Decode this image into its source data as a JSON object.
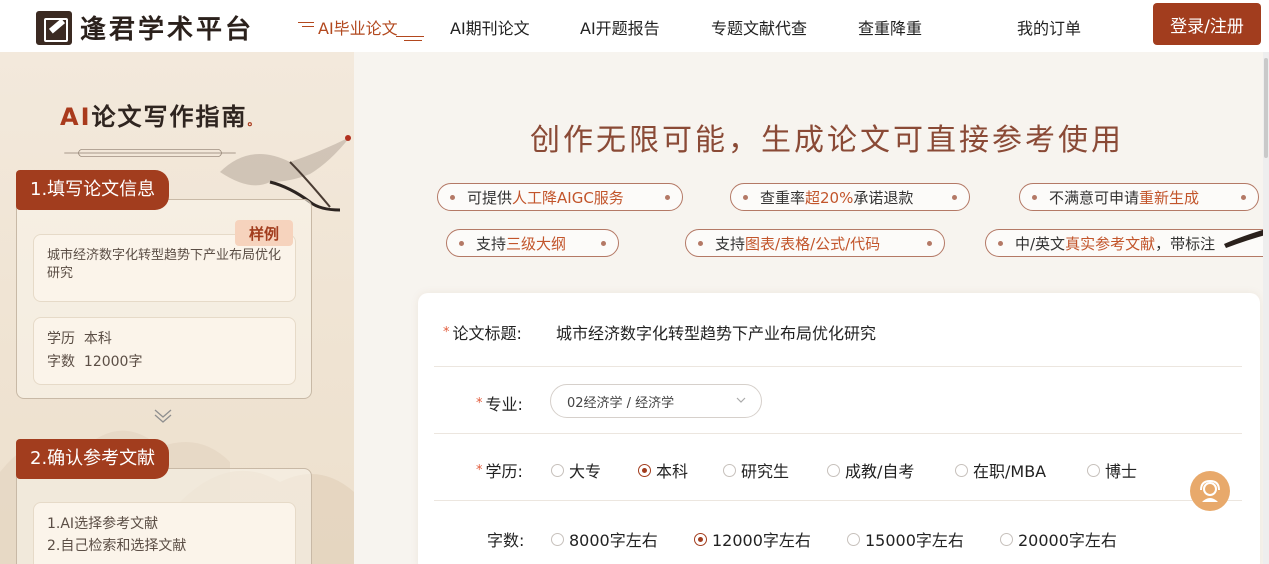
{
  "brand": {
    "name": "逢君学术平台",
    "logo_icon": "quill-logo-icon"
  },
  "nav": {
    "items": [
      {
        "label": "AI毕业论文",
        "active": true
      },
      {
        "label": "AI期刊论文",
        "active": false
      },
      {
        "label": "AI开题报告",
        "active": false
      },
      {
        "label": "专题文献代查",
        "active": false
      },
      {
        "label": "查重降重",
        "active": false
      },
      {
        "label": "我的订单",
        "active": false
      }
    ],
    "login_label": "登录/注册"
  },
  "sidebar": {
    "guide_ai": "AI",
    "guide_title": "论文写作指南",
    "guide_dot": "。",
    "step1": {
      "tag": "1.填写论文信息",
      "sample_badge": "样例",
      "sample_title": "城市经济数字化转型趋势下产业布局优化研究",
      "degree_label": "学历",
      "degree_value": "本科",
      "words_label": "字数",
      "words_value": "12000字"
    },
    "step2": {
      "tag": "2.确认参考文献",
      "line1": "1.AI选择参考文献",
      "line2": "2.自己检索和选择文献"
    }
  },
  "hero": {
    "title": "创作无限可能，生成论文可直接参考使用",
    "pills": [
      {
        "pre": "可提供",
        "hl": "人工降AIGC服务",
        "post": ""
      },
      {
        "pre": "查重率",
        "hl": "超20%",
        "post": "承诺退款"
      },
      {
        "pre": "不满意可申请",
        "hl": "重新生成",
        "post": ""
      },
      {
        "pre": "支持",
        "hl": "三级大纲",
        "post": ""
      },
      {
        "pre": "支持",
        "hl": "图表/表格/公式/代码",
        "post": ""
      },
      {
        "pre": "中/英文",
        "hl": "真实参考文献",
        "post": "，带标注"
      }
    ]
  },
  "form": {
    "title_label": "论文标题:",
    "title_value": "城市经济数字化转型趋势下产业布局优化研究",
    "major_label": "专业:",
    "major_value": "02经济学 / 经济学",
    "degree_label": "学历:",
    "degree_options": [
      "大专",
      "本科",
      "研究生",
      "成教/自考",
      "在职/MBA",
      "博士"
    ],
    "degree_selected": "本科",
    "words_label": "字数:",
    "words_options": [
      "8000字左右",
      "12000字左右",
      "15000字左右",
      "20000字左右"
    ],
    "words_selected": "12000字左右",
    "required_mark": "*"
  },
  "colors": {
    "brand": "#a23d1e",
    "accent_text": "#c2552b",
    "title": "#8a4a36"
  }
}
